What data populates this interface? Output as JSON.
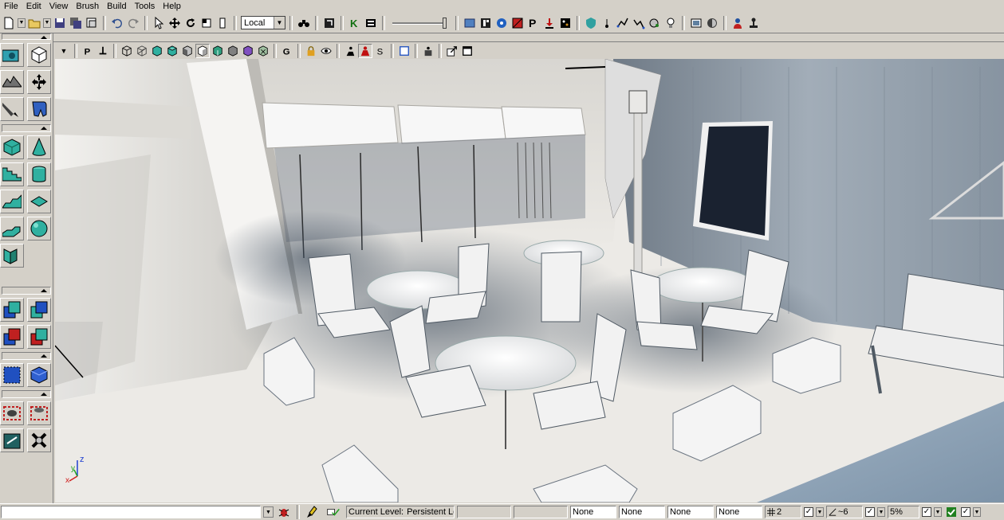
{
  "menu": [
    "File",
    "Edit",
    "View",
    "Brush",
    "Build",
    "Tools",
    "Help"
  ],
  "toolbar": {
    "coordinate_system": "Local"
  },
  "viewport": {
    "axes": {
      "x": "x",
      "y": "y",
      "z": "z"
    }
  },
  "statusbar": {
    "current_level_label": "Current Level:",
    "current_level_value": "Persistent Le",
    "snap_fields": [
      "None",
      "None",
      "None",
      "None"
    ],
    "grid_value": "2",
    "rotation_value": "~6",
    "scale_value": "5%"
  },
  "colors": {
    "chrome": "#d4d0c8",
    "viewport_wall": "#8e9aa6",
    "viewport_floor": "#eceae6",
    "shadow_blue": "#3c4a5a"
  }
}
